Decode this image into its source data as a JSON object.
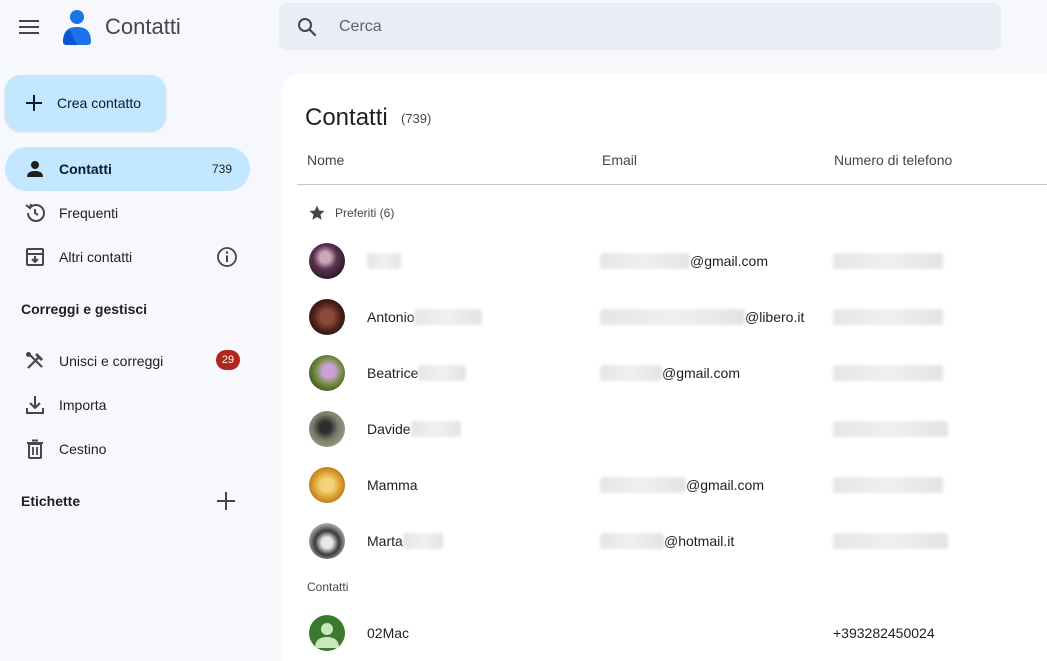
{
  "header": {
    "app_title": "Contatti",
    "search_placeholder": "Cerca"
  },
  "sidebar": {
    "create_label": "Crea contatto",
    "items": [
      {
        "label": "Contatti",
        "count": "739",
        "icon": "person-icon"
      },
      {
        "label": "Frequenti",
        "icon": "history-icon"
      },
      {
        "label": "Altri contatti",
        "icon": "archive-icon"
      }
    ],
    "manage_heading": "Correggi e gestisci",
    "manage_items": [
      {
        "label": "Unisci e correggi",
        "badge": "29",
        "icon": "merge-tools-icon"
      },
      {
        "label": "Importa",
        "icon": "download-icon"
      },
      {
        "label": "Cestino",
        "icon": "trash-icon"
      }
    ],
    "labels_heading": "Etichette"
  },
  "main": {
    "title": "Contatti",
    "count": "(739)",
    "columns": {
      "name": "Nome",
      "email": "Email",
      "phone": "Numero di telefono"
    },
    "favorites_heading": "Preferiti (6)",
    "contacts_heading": "Contatti",
    "rows": [
      {
        "name": "",
        "email_domain": "@gmail.com",
        "phone": "",
        "avatar_color": "#4a2b3f"
      },
      {
        "name": "Antonio",
        "email_domain": "@libero.it",
        "phone": "",
        "avatar_color": "#5a2b22"
      },
      {
        "name": "Beatrice",
        "email_domain": "@gmail.com",
        "phone": "",
        "avatar_color": "#6b7a3a"
      },
      {
        "name": "Davide",
        "email_domain": "",
        "phone": "",
        "avatar_color": "#6e6a58"
      },
      {
        "name": "Mamma",
        "email_domain": "@gmail.com",
        "phone": "",
        "avatar_color": "#d9a23b"
      },
      {
        "name": "Marta",
        "email_domain": "@hotmail.it",
        "phone": "",
        "avatar_color": "#3a3a3a"
      }
    ],
    "contact_rows": [
      {
        "name": "02Mac",
        "email_domain": "",
        "phone": "+393282450024",
        "avatar_color": "#3b7a2e"
      }
    ]
  },
  "colors": {
    "accent": "#c2e7ff",
    "badge": "#b3261e",
    "background": "#f6f8fc"
  }
}
